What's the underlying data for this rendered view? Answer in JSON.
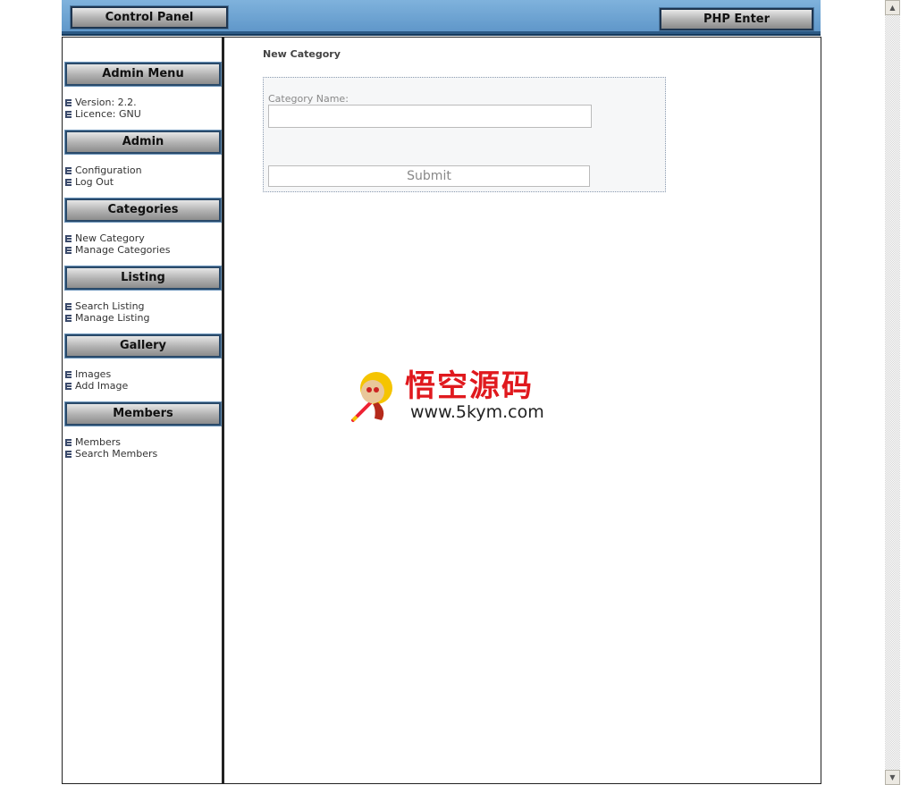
{
  "header": {
    "left_button": "Control Panel",
    "right_button": "PHP Enter"
  },
  "sidebar": {
    "sections": [
      {
        "title": "Admin Menu",
        "items": [
          "Version: 2.2.",
          "Licence: GNU"
        ]
      },
      {
        "title": "Admin",
        "items": [
          "Configuration",
          "Log Out"
        ]
      },
      {
        "title": "Categories",
        "items": [
          "New Category",
          "Manage Categories"
        ]
      },
      {
        "title": "Listing",
        "items": [
          "Search Listing",
          "Manage Listing"
        ]
      },
      {
        "title": "Gallery",
        "items": [
          "Images",
          "Add Image"
        ]
      },
      {
        "title": "Members",
        "items": [
          "Members",
          "Search Members"
        ]
      }
    ]
  },
  "main": {
    "title": "New Category",
    "form": {
      "label": "Category Name:",
      "value": "",
      "submit": "Submit"
    }
  },
  "watermark": {
    "chinese": "悟空源码",
    "url": "www.5kym.com"
  },
  "scrollbar": {
    "up": "▲",
    "down": "▼"
  }
}
